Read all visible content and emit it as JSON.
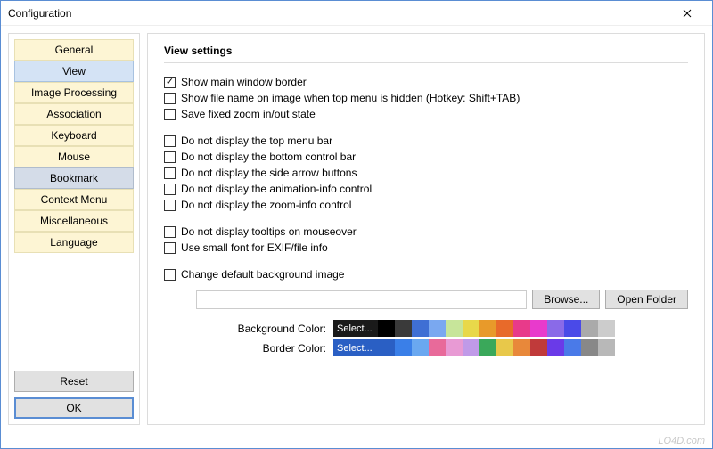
{
  "window": {
    "title": "Configuration"
  },
  "sidebar": {
    "items": [
      {
        "label": "General",
        "state": "yellow"
      },
      {
        "label": "View",
        "state": "selected"
      },
      {
        "label": "Image Processing",
        "state": "yellow"
      },
      {
        "label": "Association",
        "state": "yellow"
      },
      {
        "label": "Keyboard",
        "state": "yellow"
      },
      {
        "label": "Mouse",
        "state": "yellow"
      },
      {
        "label": "Bookmark",
        "state": "hover"
      },
      {
        "label": "Context Menu",
        "state": "yellow"
      },
      {
        "label": "Miscellaneous",
        "state": "yellow"
      },
      {
        "label": "Language",
        "state": "yellow"
      }
    ],
    "reset": "Reset",
    "ok": "OK"
  },
  "main": {
    "heading": "View settings",
    "checks": [
      {
        "label": "Show main window border",
        "checked": true
      },
      {
        "label": "Show file name on image when top menu is hidden (Hotkey: Shift+TAB)",
        "checked": false
      },
      {
        "label": "Save fixed zoom in/out state",
        "checked": false
      }
    ],
    "checks2": [
      {
        "label": "Do not display the top menu bar",
        "checked": false
      },
      {
        "label": "Do not display the bottom control bar",
        "checked": false
      },
      {
        "label": "Do not display the side arrow buttons",
        "checked": false
      },
      {
        "label": "Do not display the animation-info control",
        "checked": false
      },
      {
        "label": "Do not display the zoom-info control",
        "checked": false
      }
    ],
    "checks3": [
      {
        "label": "Do not display tooltips on mouseover",
        "checked": false
      },
      {
        "label": "Use small font for EXIF/file info",
        "checked": false
      }
    ],
    "checks4": [
      {
        "label": "Change default background image",
        "checked": false
      }
    ],
    "browse": "Browse...",
    "openFolder": "Open Folder",
    "bgLabel": "Background Color:",
    "borderLabel": "Border Color:",
    "select": "Select...",
    "bgColors": [
      "#000000",
      "#3a3a3a",
      "#3f6fd4",
      "#7aa8f0",
      "#c7e59a",
      "#e8d84a",
      "#e89a2a",
      "#e86a2a",
      "#e83a8a",
      "#e83acc",
      "#8a6ae8",
      "#4a4ae8",
      "#aaaaaa",
      "#cccccc"
    ],
    "borderColors": [
      "#2a5fc4",
      "#3a7fe8",
      "#6aa8f0",
      "#e86a9a",
      "#e89ad4",
      "#c09ae8",
      "#3aa85a",
      "#e8c84a",
      "#e8883a",
      "#c03a3a",
      "#6a3ae8",
      "#4a7ae8",
      "#888888",
      "#b8b8b8"
    ]
  },
  "watermark": "LO4D.com"
}
